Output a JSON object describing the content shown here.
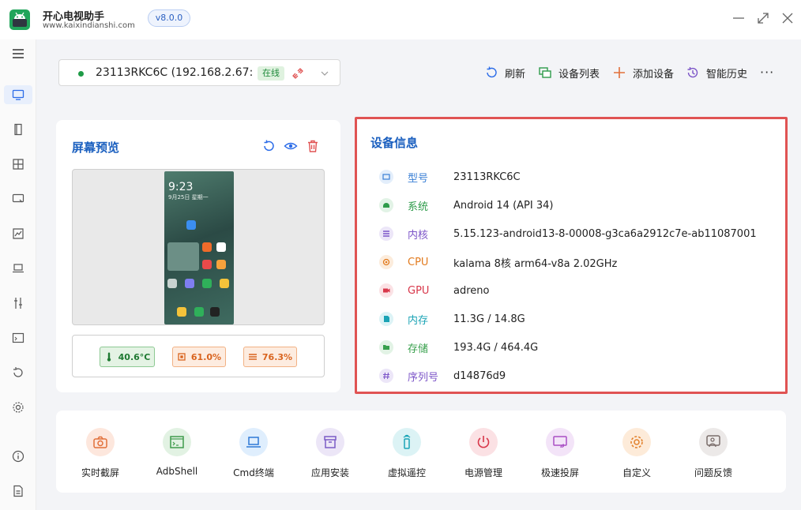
{
  "app": {
    "name": "开心电视助手",
    "site": "www.kaixindianshi.com",
    "version": "v8.0.0"
  },
  "device": {
    "name": "23113RKC6C (192.168.2.67:...",
    "status": "在线"
  },
  "toolbar": {
    "refresh": "刷新",
    "device_list": "设备列表",
    "add_device": "添加设备",
    "history": "智能历史",
    "more": "···"
  },
  "preview": {
    "title": "屏幕预览",
    "phone_time": "9:23",
    "phone_date": "9月25日 星期一",
    "temperature": "40.6°C",
    "cpu_usage": "61.0%",
    "memory_usage": "76.3%"
  },
  "info": {
    "title": "设备信息",
    "rows": [
      {
        "label": "型号",
        "value": "23113RKC6C",
        "color": "#3a7fd5",
        "bg": "#e3eefb",
        "icon": "model-icon"
      },
      {
        "label": "系统",
        "value": "Android 14 (API 34)",
        "color": "#2e9b4a",
        "bg": "#e2f3e6",
        "icon": "android-icon"
      },
      {
        "label": "内核",
        "value": "5.15.123-android13-8-00008-g3ca6a2912c7e-ab11087001",
        "color": "#7c55c8",
        "bg": "#ece6f8",
        "icon": "kernel-icon"
      },
      {
        "label": "CPU",
        "value": "kalama 8核 arm64-v8a 2.02GHz",
        "color": "#e27b1f",
        "bg": "#fcecdc",
        "icon": "cpu-icon"
      },
      {
        "label": "GPU",
        "value": "adreno",
        "color": "#d8374a",
        "bg": "#fbe2e5",
        "icon": "gpu-icon"
      },
      {
        "label": "内存",
        "value": "11.3G / 14.8G",
        "color": "#1aa3b5",
        "bg": "#dcf3f6",
        "icon": "memory-icon"
      },
      {
        "label": "存储",
        "value": "193.4G / 464.4G",
        "color": "#38a04d",
        "bg": "#e2f3e5",
        "icon": "storage-icon"
      },
      {
        "label": "序列号",
        "value": "d14876d9",
        "color": "#7c55c8",
        "bg": "#ece6f8",
        "icon": "serial-icon"
      }
    ]
  },
  "tools": [
    {
      "label": "实时截屏",
      "color": "#e2703a",
      "bg": "#fde7dd",
      "icon": "camera-icon"
    },
    {
      "label": "AdbShell",
      "color": "#3f9b4c",
      "bg": "#e2f2e3",
      "icon": "terminal-icon"
    },
    {
      "label": "Cmd终端",
      "color": "#2f78d6",
      "bg": "#dfeefd",
      "icon": "laptop-icon"
    },
    {
      "label": "应用安装",
      "color": "#7b5bc6",
      "bg": "#ece6f7",
      "icon": "package-icon"
    },
    {
      "label": "虚拟遥控",
      "color": "#1ba5b6",
      "bg": "#dcf3f5",
      "icon": "remote-icon"
    },
    {
      "label": "电源管理",
      "color": "#d8374a",
      "bg": "#fbe1e4",
      "icon": "power-icon"
    },
    {
      "label": "极速投屏",
      "color": "#a94fc4",
      "bg": "#f3e4f8",
      "icon": "cast-icon"
    },
    {
      "label": "自定义",
      "color": "#e2812c",
      "bg": "#fdebd9",
      "icon": "gear-icon"
    },
    {
      "label": "问题反馈",
      "color": "#7a6d6a",
      "bg": "#ece9e8",
      "icon": "feedback-icon"
    }
  ]
}
